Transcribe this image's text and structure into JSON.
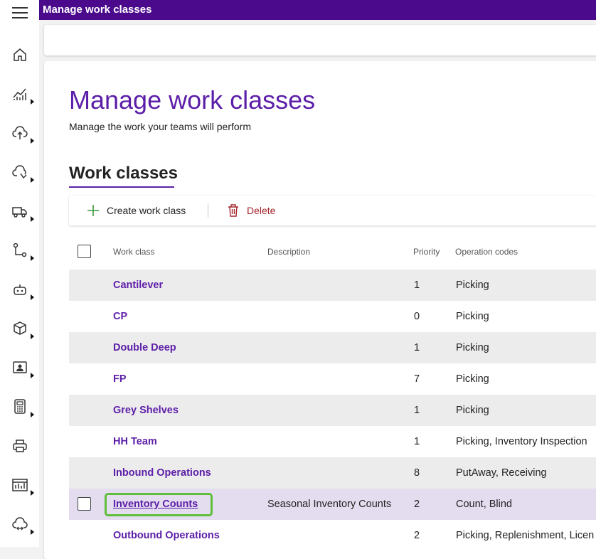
{
  "app": {
    "title": "Manage work classes"
  },
  "nav": {
    "items": [
      {
        "icon": "home-icon",
        "has_submenu": false
      },
      {
        "icon": "analytics-icon",
        "has_submenu": true
      },
      {
        "icon": "cloud-upload-icon",
        "has_submenu": true
      },
      {
        "icon": "cloud-sync-icon",
        "has_submenu": true
      },
      {
        "icon": "truck-icon",
        "has_submenu": true
      },
      {
        "icon": "flow-icon",
        "has_submenu": true
      },
      {
        "icon": "robot-icon",
        "has_submenu": true
      },
      {
        "icon": "box-icon",
        "has_submenu": true
      },
      {
        "icon": "contact-card-icon",
        "has_submenu": true
      },
      {
        "icon": "calculator-icon",
        "has_submenu": true
      },
      {
        "icon": "printer-icon",
        "has_submenu": false
      },
      {
        "icon": "report-icon",
        "has_submenu": true
      },
      {
        "icon": "cloud-transfer-icon",
        "has_submenu": true
      }
    ]
  },
  "page": {
    "title": "Manage work classes",
    "subtitle": "Manage the work your teams will perform",
    "section_title": "Work classes"
  },
  "actions": {
    "create_label": "Create work class",
    "delete_label": "Delete"
  },
  "table": {
    "columns": [
      "Work class",
      "Description",
      "Priority",
      "Operation codes"
    ],
    "rows": [
      {
        "work_class": "Cantilever",
        "description": "",
        "priority": "1",
        "operation_codes": "Picking"
      },
      {
        "work_class": "CP",
        "description": "",
        "priority": "0",
        "operation_codes": "Picking"
      },
      {
        "work_class": "Double Deep",
        "description": "",
        "priority": "1",
        "operation_codes": "Picking"
      },
      {
        "work_class": "FP",
        "description": "",
        "priority": "7",
        "operation_codes": "Picking"
      },
      {
        "work_class": "Grey Shelves",
        "description": "",
        "priority": "1",
        "operation_codes": "Picking"
      },
      {
        "work_class": "HH Team",
        "description": "",
        "priority": "1",
        "operation_codes": "Picking, Inventory Inspection"
      },
      {
        "work_class": "Inbound Operations",
        "description": "",
        "priority": "8",
        "operation_codes": "PutAway, Receiving"
      },
      {
        "work_class": "Inventory Counts",
        "description": "Seasonal Inventory Counts",
        "priority": "2",
        "operation_codes": "Count, Blind"
      },
      {
        "work_class": "Outbound Operations",
        "description": "",
        "priority": "2",
        "operation_codes": "Picking, Replenishment, Licen"
      }
    ]
  },
  "colors": {
    "brand": "#4b0a8c",
    "accent": "#5c1ea8",
    "highlight": "#5fbf3a",
    "delete": "#a4262c"
  }
}
